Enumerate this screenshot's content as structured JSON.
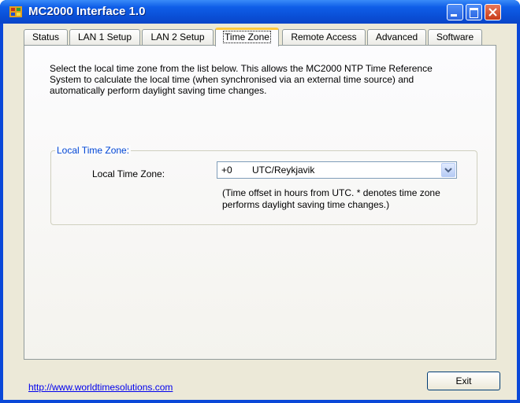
{
  "window": {
    "title": "MC2000 Interface 1.0"
  },
  "tabs": [
    {
      "label": "Status"
    },
    {
      "label": "LAN 1 Setup"
    },
    {
      "label": "LAN 2 Setup"
    },
    {
      "label": "Time Zone"
    },
    {
      "label": "Remote Access"
    },
    {
      "label": "Advanced"
    },
    {
      "label": "Software"
    }
  ],
  "active_tab": "Time Zone",
  "panel": {
    "description": "Select the local time zone from the list below.  This allows the MC2000 NTP Time Reference System to calculate the local time (when synchronised via an external time source) and automatically perform daylight saving time changes.",
    "group_title": "Local Time Zone:",
    "field_label": "Local Time Zone:",
    "timezone": {
      "offset": "+0",
      "name": "UTC/Reykjavik"
    },
    "note": "(Time offset in hours from UTC.  * denotes time zone performs daylight saving time changes.)"
  },
  "footer": {
    "link": "http://www.worldtimesolutions.com",
    "exit_label": "Exit"
  }
}
